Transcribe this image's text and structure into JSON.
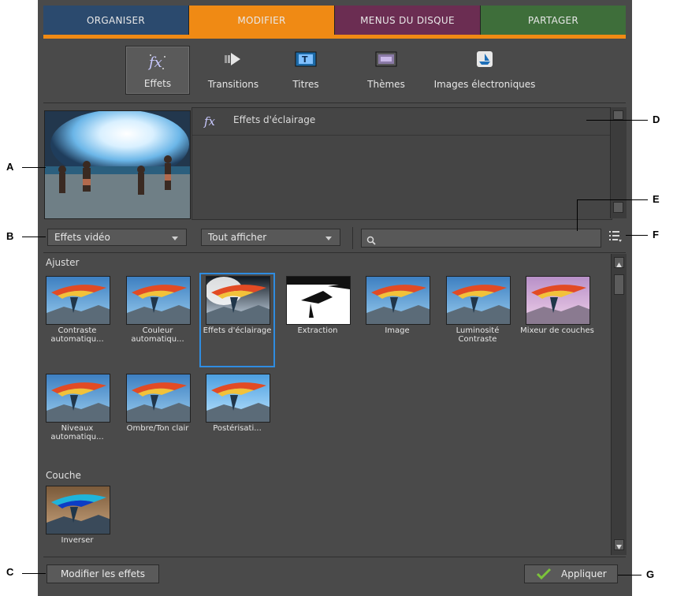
{
  "tabs": [
    {
      "label": "ORGANISER",
      "color": "#2b4a6e"
    },
    {
      "label": "MODIFIER",
      "color": "#f08a14"
    },
    {
      "label": "MENUS DU DISQUE",
      "color": "#6b2d52"
    },
    {
      "label": "PARTAGER",
      "color": "#3e6e3a"
    }
  ],
  "toolbar": {
    "effets": "Effets",
    "transitions": "Transitions",
    "titres": "Titres",
    "themes": "Thèmes",
    "images": "Images électroniques"
  },
  "info": {
    "title": "Effets d'éclairage"
  },
  "filters": {
    "category": "Effets vidéo",
    "show": "Tout afficher",
    "search_placeholder": ""
  },
  "sections": [
    {
      "label": "Ajuster",
      "items": [
        {
          "caption": "Contraste automatiqu..."
        },
        {
          "caption": "Couleur automatiqu..."
        },
        {
          "caption": "Effets d'éclairage",
          "selected": true
        },
        {
          "caption": "Extraction"
        },
        {
          "caption": "Image"
        },
        {
          "caption": "Luminosité Contraste"
        },
        {
          "caption": "Mixeur de couches"
        },
        {
          "caption": "Niveaux automatiqu..."
        },
        {
          "caption": "Ombre/Ton clair"
        },
        {
          "caption": "Postérisati..."
        }
      ]
    },
    {
      "label": "Couche",
      "items": [
        {
          "caption": "Inverser"
        }
      ]
    }
  ],
  "buttons": {
    "edit": "Modifier les effets",
    "apply": "Appliquer"
  },
  "callouts": {
    "A": "A",
    "B": "B",
    "C": "C",
    "D": "D",
    "E": "E",
    "F": "F",
    "G": "G"
  },
  "colors": {
    "selection": "#2f8ce0",
    "accent": "#f08a14",
    "panel": "#4a4a4a",
    "apply_check": "#7cc43a"
  }
}
